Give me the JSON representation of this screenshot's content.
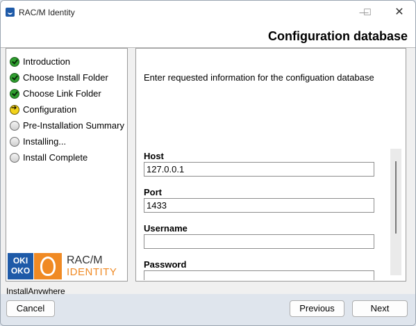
{
  "window": {
    "title": "RAC/M Identity",
    "controls": {
      "minimize": "—",
      "maximize": "☐",
      "close": "✕"
    }
  },
  "header": {
    "title": "Configuration database"
  },
  "steps": [
    {
      "label": "Introduction",
      "status": "done",
      "icon": "check-circle-icon"
    },
    {
      "label": "Choose Install Folder",
      "status": "done",
      "icon": "check-circle-icon"
    },
    {
      "label": "Choose Link Folder",
      "status": "done",
      "icon": "check-circle-icon"
    },
    {
      "label": "Configuration",
      "status": "current",
      "icon": "arrow-circle-icon"
    },
    {
      "label": "Pre-Installation Summary",
      "status": "pending",
      "icon": "empty-circle-icon"
    },
    {
      "label": "Installing...",
      "status": "pending",
      "icon": "empty-circle-icon"
    },
    {
      "label": "Install Complete",
      "status": "pending",
      "icon": "empty-circle-icon"
    }
  ],
  "logo": {
    "oki_line1": "OKI",
    "oki_line2": "OKO",
    "product_line1": "RAC/M",
    "product_line2": "IDENTITY"
  },
  "main": {
    "instructions": "Enter requested information for the configuation database",
    "fields": {
      "host": {
        "label": "Host",
        "value": "127.0.0.1"
      },
      "port": {
        "label": "Port",
        "value": "1433"
      },
      "username": {
        "label": "Username",
        "value": ""
      },
      "password": {
        "label": "Password",
        "value": ""
      }
    }
  },
  "footer": {
    "brand": "InstallAnywhere",
    "cancel": "Cancel",
    "previous": "Previous",
    "next": "Next"
  },
  "colors": {
    "done": "#2f9e2f",
    "current": "#f2d21a",
    "accent": "#1e5aa8",
    "brand_orange": "#f08a24"
  }
}
